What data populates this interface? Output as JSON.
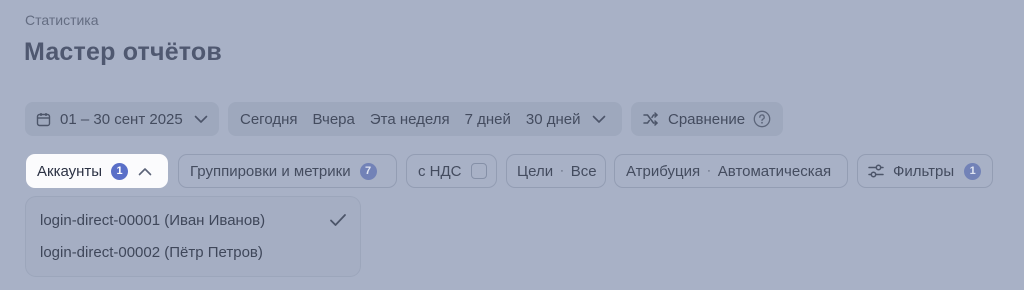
{
  "header": {
    "breadcrumb": "Статистика",
    "title": "Мастер отчётов"
  },
  "period": {
    "date_range": "01 – 30 сент 2025",
    "quick_ranges": [
      "Сегодня",
      "Вчера",
      "Эта неделя",
      "7 дней",
      "30 дней"
    ],
    "compare_label": "Сравнение"
  },
  "filters": {
    "accounts": {
      "label": "Аккаунты",
      "count": "1",
      "expanded": true
    },
    "groupings": {
      "label": "Группировки и метрики",
      "count": "7"
    },
    "vat": {
      "label": "с НДС",
      "checked": false
    },
    "goals": {
      "label": "Цели",
      "value": "Все"
    },
    "attribution": {
      "label": "Атрибуция",
      "value": "Автоматическая"
    },
    "filters_button": {
      "label": "Фильтры",
      "count": "1"
    },
    "separator": "·"
  },
  "accounts_dropdown": {
    "items": [
      {
        "label": "login-direct-00001 (Иван Иванов)",
        "selected": true
      },
      {
        "label": "login-direct-00002 (Пётр Петров)",
        "selected": false
      }
    ]
  },
  "icons": {
    "calendar": "calendar-icon",
    "chevron_down": "chevron-down-icon",
    "chevron_up": "chevron-up-icon",
    "shuffle": "shuffle-icon",
    "help": "help-icon",
    "filters": "sliders-icon",
    "check": "check-icon"
  },
  "colors": {
    "overlay_bg": "#a8b1c6",
    "badge_active": "#5a6fc8",
    "badge_dimmed": "#7282b7"
  }
}
